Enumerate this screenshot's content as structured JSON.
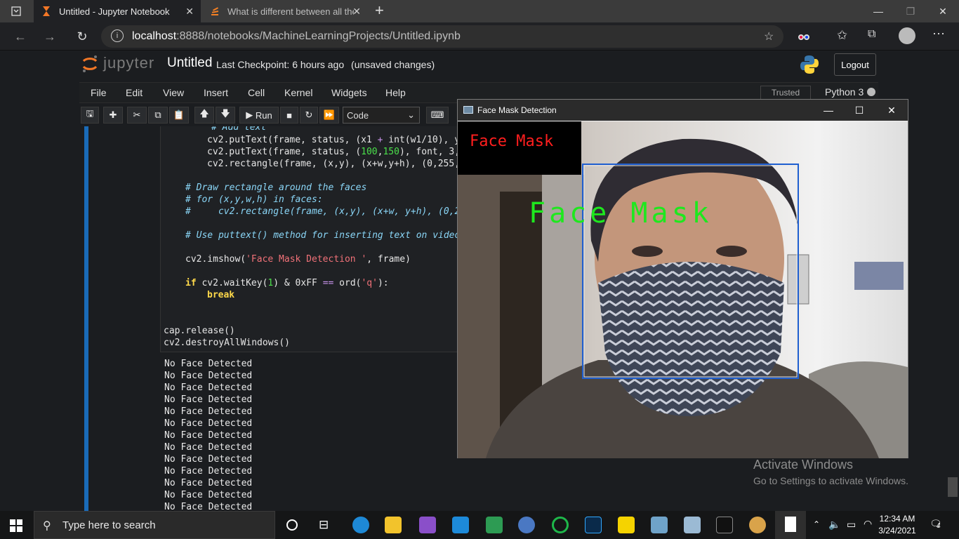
{
  "browser": {
    "tabs": [
      {
        "title": "Untitled - Jupyter Notebook",
        "active": true
      },
      {
        "title": "What is different between all the",
        "active": false
      }
    ],
    "new_tab_label": "+",
    "url_host": "localhost",
    "url_path": ":8888/notebooks/MachineLearningProjects/Untitled.ipynb"
  },
  "jupyter": {
    "logo_text": "jupyter",
    "notebook_title": "Untitled",
    "checkpoint_label": "Last Checkpoint:",
    "checkpoint_time": "6 hours ago",
    "unsaved": "(unsaved changes)",
    "logout_label": "Logout",
    "menu": [
      "File",
      "Edit",
      "View",
      "Insert",
      "Cell",
      "Kernel",
      "Widgets",
      "Help"
    ],
    "trusted_label": "Trusted",
    "kernel_name": "Python 3",
    "run_label": "Run",
    "cell_type": "Code"
  },
  "code_lines": {
    "l1": "# Add text",
    "l2a": "cv2.putText(frame, status, (x1 ",
    "l2b": "+",
    "l2c": " int(w1/10), y",
    "l3a": "cv2.putText(frame, status, (",
    "l3b": "100",
    "l3c": ",",
    "l3d": "150",
    "l3e": "), font, 3,",
    "l4": "cv2.rectangle(frame, (x,y), (x+w,y+h), (0,255,",
    "c1": "# Draw rectangle around the faces",
    "c2": "# for (x,y,w,h) in faces:",
    "c3": "#     cv2.rectangle(frame, (x,y), (x+w, y+h), (0,2",
    "c4": "# Use puttext() method for inserting text on video",
    "imshow_a": "cv2.imshow(",
    "imshow_str": "'Face Mask Detection '",
    "imshow_b": ", frame)",
    "if_kw": "if",
    "if_a": " cv2.waitKey(",
    "if_num": "1",
    "if_b": ") & 0xFF ",
    "if_op": "==",
    "if_c": " ord(",
    "if_str": "'q'",
    "if_d": "):",
    "break_kw": "break",
    "release": "cap.release()",
    "destroy": "cv2.destroyAllWindows()"
  },
  "outputs": [
    "No Face Detected",
    "No Face Detected",
    "No Face Detected",
    "No Face Detected",
    "No Face Detected",
    "No Face Detected",
    "No Face Detected",
    "No Face Detected",
    "No Face Detected",
    "No Face Detected",
    "No Face Detected",
    "No Face Detected",
    "No Face Detected"
  ],
  "cv_window": {
    "title": "Face Mask Detection",
    "status_small": "Face Mask",
    "status_large": "Face Mask"
  },
  "activate": {
    "title": "Activate Windows",
    "subtitle": "Go to Settings to activate Windows."
  },
  "taskbar": {
    "search_placeholder": "Type here to search",
    "time": "12:34 AM",
    "date": "3/24/2021",
    "notification_count": "4"
  },
  "colors": {
    "cell_accent": "#1a6bb8",
    "comment": "#8ad6f7",
    "string": "#f07178",
    "keyword": "#ffd94a",
    "cv_text_red": "#ff1e1e",
    "cv_text_green": "#1ee81e",
    "cv_box": "#1f5fd0"
  }
}
